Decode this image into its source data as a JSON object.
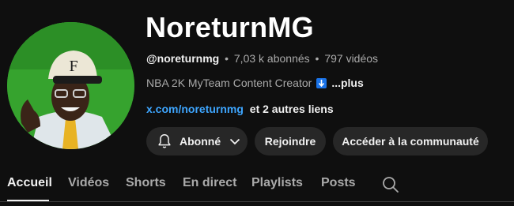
{
  "channel": {
    "name": "NoreturnMG",
    "handle": "@noreturnmg",
    "subscribers": "7,03 k abonnés",
    "videos": "797 vidéos",
    "separator": "•",
    "description": "NBA 2K MyTeam Content Creator",
    "description_emoji": "down-arrow-emoji",
    "more_label": "...plus",
    "link": "x.com/noreturnmg",
    "other_links": "et 2 autres liens"
  },
  "buttons": {
    "subscribed_label": "Abonné",
    "join_label": "Rejoindre",
    "community_label": "Accéder à la communauté"
  },
  "tabs": [
    {
      "label": "Accueil",
      "active": true
    },
    {
      "label": "Vidéos"
    },
    {
      "label": "Shorts"
    },
    {
      "label": "En direct"
    },
    {
      "label": "Playlists"
    },
    {
      "label": "Posts"
    }
  ],
  "icons": {
    "bell": "bell-icon",
    "chevron": "chevron-down-icon",
    "search": "search-icon"
  },
  "colors": {
    "background": "#0f0f0f",
    "link": "#3ea6ff",
    "button_bg": "#272727",
    "avatar_bg": "#2f9e2a"
  }
}
